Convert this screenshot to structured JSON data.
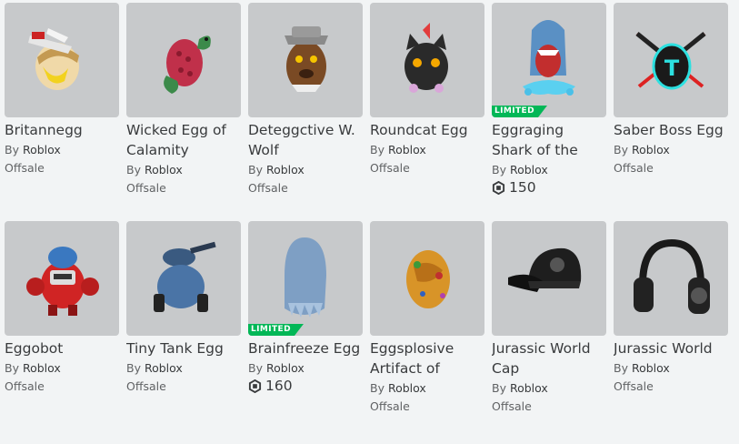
{
  "by_prefix": "By",
  "rows": [
    [
      {
        "name": "Britannegg",
        "creator": "Roblox",
        "price": "Offsale",
        "limited": false,
        "icon": "britannegg-thumbnail"
      },
      {
        "name": "Wicked Egg of Calamity",
        "creator": "Roblox",
        "price": "Offsale",
        "limited": false,
        "icon": "wicked-egg-thumbnail"
      },
      {
        "name": "Deteggctive W. Wolf",
        "creator": "Roblox",
        "price": "Offsale",
        "limited": false,
        "icon": "wolf-egg-thumbnail"
      },
      {
        "name": "Roundcat Egg",
        "creator": "Roblox",
        "price": "Offsale",
        "limited": false,
        "icon": "roundcat-egg-thumbnail"
      },
      {
        "name": "Eggraging Shark of the",
        "creator": "Roblox",
        "price": "150",
        "limited": true,
        "limited_label": "LIMITED",
        "icon": "shark-egg-thumbnail"
      },
      {
        "name": "Saber Boss Egg",
        "creator": "Roblox",
        "price": "Offsale",
        "limited": false,
        "icon": "saber-egg-thumbnail"
      }
    ],
    [
      {
        "name": "Eggobot",
        "creator": "Roblox",
        "price": "Offsale",
        "limited": false,
        "icon": "eggobot-thumbnail"
      },
      {
        "name": "Tiny Tank Egg",
        "creator": "Roblox",
        "price": "Offsale",
        "limited": false,
        "icon": "tank-egg-thumbnail"
      },
      {
        "name": "Brainfreeze Egg",
        "creator": "Roblox",
        "price": "160",
        "limited": true,
        "limited_label": "LIMITED",
        "icon": "brainfreeze-egg-thumbnail"
      },
      {
        "name": "Eggsplosive Artifact of",
        "creator": "Roblox",
        "price": "Offsale",
        "limited": false,
        "icon": "artifact-egg-thumbnail"
      },
      {
        "name": "Jurassic World Cap",
        "creator": "Roblox",
        "price": "Offsale",
        "limited": false,
        "icon": "jurassic-cap-thumbnail"
      },
      {
        "name": "Jurassic World",
        "creator": "Roblox",
        "price": "Offsale",
        "limited": false,
        "icon": "jurassic-headphones-thumbnail"
      }
    ]
  ],
  "colors": {
    "background": "#f2f4f5",
    "thumb": "#c7c9cb",
    "limited": "#02b757",
    "text": "#393b3d",
    "subtext": "#606264"
  }
}
